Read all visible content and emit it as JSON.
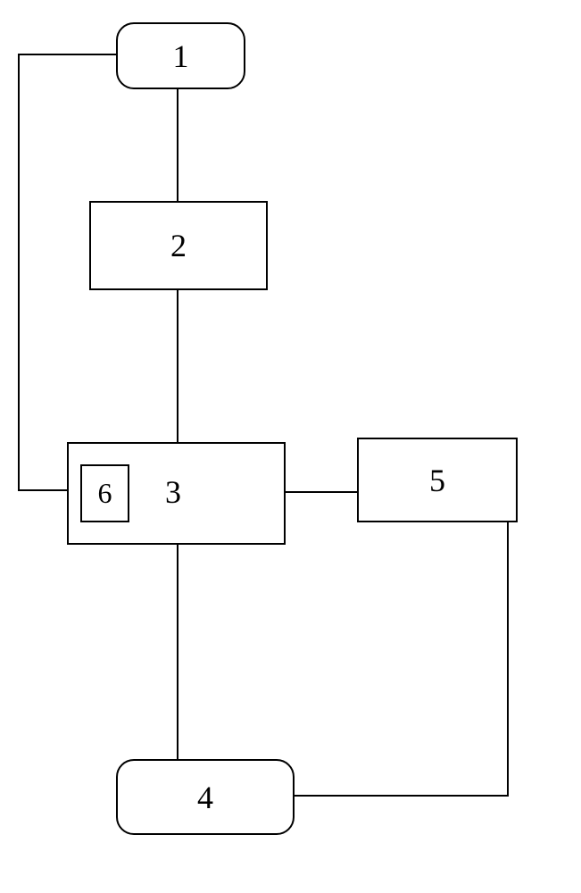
{
  "diagram": {
    "nodes": {
      "node1": {
        "label": "1"
      },
      "node2": {
        "label": "2"
      },
      "node3": {
        "label": "3"
      },
      "node4": {
        "label": "4"
      },
      "node5": {
        "label": "5"
      },
      "node6": {
        "label": "6"
      }
    },
    "connections": [
      {
        "from": "1",
        "to": "2"
      },
      {
        "from": "2",
        "to": "3"
      },
      {
        "from": "3",
        "to": "4"
      },
      {
        "from": "3",
        "to": "5"
      },
      {
        "from": "4",
        "to": "5"
      },
      {
        "from": "1",
        "to": "3"
      }
    ]
  }
}
